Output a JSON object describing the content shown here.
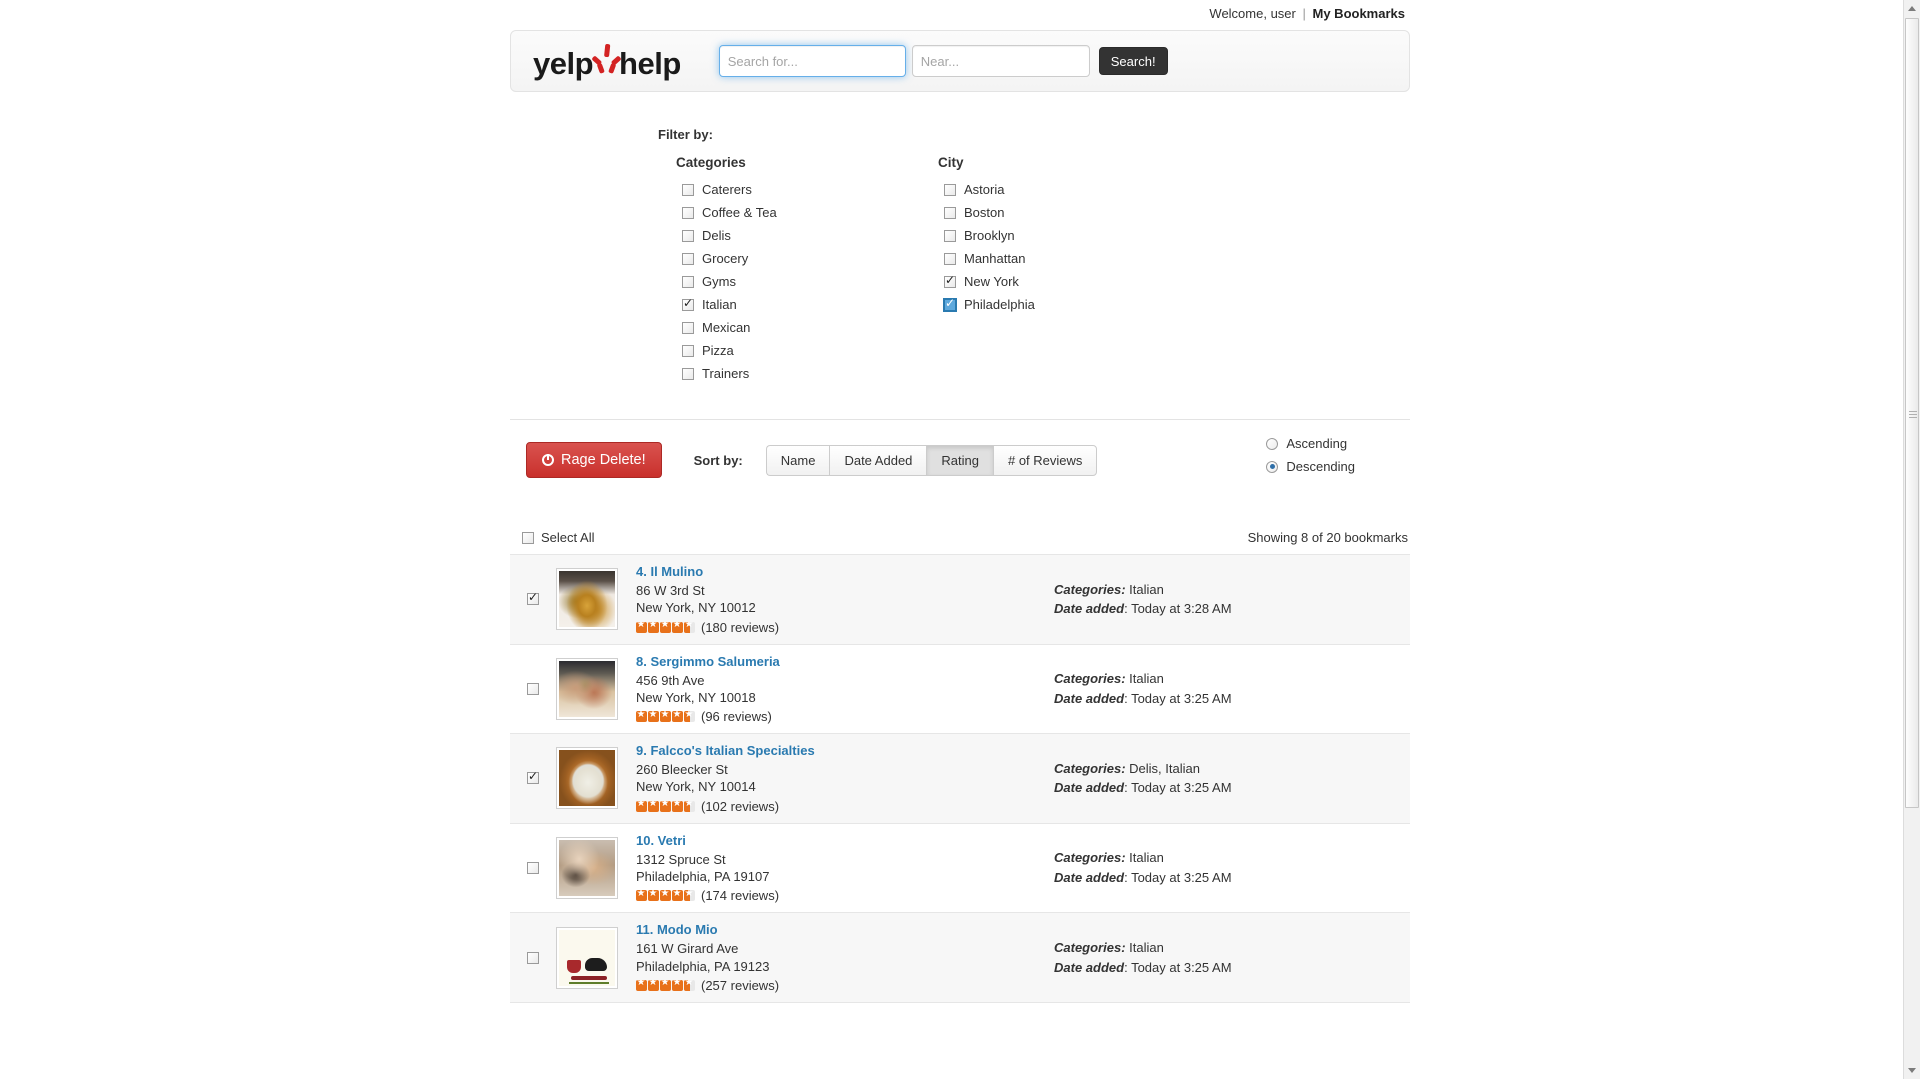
{
  "topbar": {
    "welcome_text": "Welcome, user",
    "separator": "|",
    "bookmarks_label": "My Bookmarks"
  },
  "header": {
    "logo_left": "yelp",
    "logo_right": "help",
    "logo_icon": "yelp-burst-icon",
    "search_for_value": "",
    "search_for_placeholder": "Search for...",
    "search_near_value": "",
    "search_near_placeholder": "Near...",
    "search_button_label": "Search!"
  },
  "filters": {
    "title": "Filter by:",
    "groups": [
      {
        "heading": "Categories",
        "options": [
          {
            "label": "Caterers",
            "checked": false,
            "focused": false
          },
          {
            "label": "Coffee & Tea",
            "checked": false,
            "focused": false
          },
          {
            "label": "Delis",
            "checked": false,
            "focused": false
          },
          {
            "label": "Grocery",
            "checked": false,
            "focused": false
          },
          {
            "label": "Gyms",
            "checked": false,
            "focused": false
          },
          {
            "label": "Italian",
            "checked": true,
            "focused": false
          },
          {
            "label": "Mexican",
            "checked": false,
            "focused": false
          },
          {
            "label": "Pizza",
            "checked": false,
            "focused": false
          },
          {
            "label": "Trainers",
            "checked": false,
            "focused": false
          }
        ]
      },
      {
        "heading": "City",
        "options": [
          {
            "label": "Astoria",
            "checked": false,
            "focused": false
          },
          {
            "label": "Boston",
            "checked": false,
            "focused": false
          },
          {
            "label": "Brooklyn",
            "checked": false,
            "focused": false
          },
          {
            "label": "Manhattan",
            "checked": false,
            "focused": false
          },
          {
            "label": "New York",
            "checked": true,
            "focused": false
          },
          {
            "label": "Philadelphia",
            "checked": true,
            "focused": true
          }
        ]
      }
    ]
  },
  "toolbar": {
    "delete_label": "Rage Delete!",
    "delete_icon": "ban-circle-icon",
    "sort_label": "Sort by:",
    "sort_options": [
      {
        "label": "Name",
        "active": false
      },
      {
        "label": "Date Added",
        "active": false
      },
      {
        "label": "Rating",
        "active": true
      },
      {
        "label": "# of Reviews",
        "active": false
      }
    ],
    "order_options": [
      {
        "label": "Ascending",
        "selected": false
      },
      {
        "label": "Descending",
        "selected": true
      }
    ]
  },
  "list_header": {
    "select_all_label": "Select All",
    "select_all_checked": false,
    "showing_text": "Showing 8 of 20 bookmarks"
  },
  "bookmarks": [
    {
      "title": "4. Il Mulino",
      "street": "86 W 3rd St",
      "citystate": "New York, NY 10012",
      "rating": 4.5,
      "reviews": "(180 reviews)",
      "categories_label": "Categories:",
      "categories_value": "Italian",
      "date_label": "Date added",
      "date_value": "Today at 3:28 AM",
      "checked": true,
      "shaded": true,
      "thumb": "photo-pasta-plate"
    },
    {
      "title": "8. Sergimmo Salumeria",
      "street": "456 9th Ave",
      "citystate": "New York, NY 10018",
      "rating": 4.5,
      "reviews": "(96 reviews)",
      "categories_label": "Categories:",
      "categories_value": "Italian",
      "date_label": "Date added",
      "date_value": "Today at 3:25 AM",
      "checked": false,
      "shaded": false,
      "thumb": "photo-sandwiches"
    },
    {
      "title": "9. Falcco's Italian Specialties",
      "street": "260 Bleecker St",
      "citystate": "New York, NY 10014",
      "rating": 4.5,
      "reviews": "(102 reviews)",
      "categories_label": "Categories:",
      "categories_value": "Delis, Italian",
      "date_label": "Date added",
      "date_value": "Today at 3:25 AM",
      "checked": true,
      "shaded": true,
      "thumb": "photo-riceball"
    },
    {
      "title": "10. Vetri",
      "street": "1312 Spruce St",
      "citystate": "Philadelphia, PA 19107",
      "rating": 4.5,
      "reviews": "(174 reviews)",
      "categories_label": "Categories:",
      "categories_value": "Italian",
      "date_label": "Date added",
      "date_value": "Today at 3:25 AM",
      "checked": false,
      "shaded": false,
      "thumb": "photo-dish-closeup"
    },
    {
      "title": "11. Modo Mio",
      "street": "161 W Girard Ave",
      "citystate": "Philadelphia, PA 19123",
      "rating": 4.5,
      "reviews": "(257 reviews)",
      "categories_label": "Categories:",
      "categories_value": "Italian",
      "date_label": "Date added",
      "date_value": "Today at 3:25 AM",
      "checked": false,
      "shaded": true,
      "thumb": "logo-modomio"
    }
  ],
  "colors": {
    "link": "#2a7ab0",
    "danger": "#c9302c",
    "star": "#e8711a",
    "brand_red": "#d32323"
  }
}
